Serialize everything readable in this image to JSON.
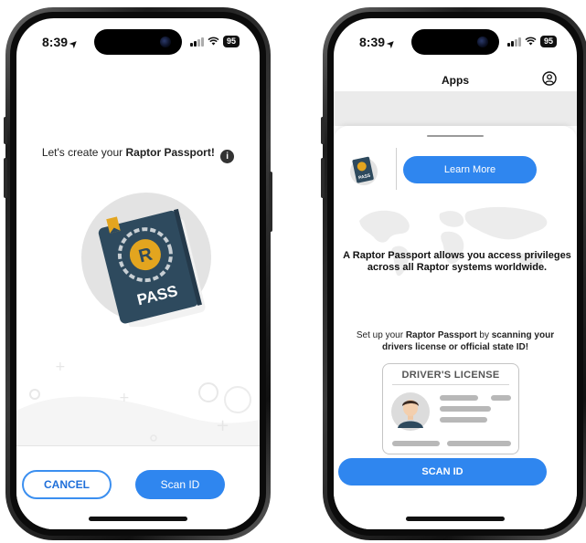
{
  "phone1": {
    "status": {
      "time": "8:39",
      "battery": "95"
    },
    "intro_prefix": "Let's create your ",
    "intro_brand": "Raptor Passport!",
    "info_glyph": "i",
    "pass_letter": "R",
    "pass_label": "PASS",
    "cancel_label": "CANCEL",
    "scan_label": "Scan ID"
  },
  "phone2": {
    "status": {
      "time": "8:39",
      "battery": "95"
    },
    "nav_title": "Apps",
    "learn_more_label": "Learn More",
    "mini_pass_label": "PASS",
    "access_text": "A Raptor Passport allows you access privileges across all Raptor systems worldwide.",
    "setup_prefix": "Set up your ",
    "setup_brand": "Raptor Passport",
    "setup_mid": " by ",
    "setup_bold": "scanning your drivers license or official state ID!",
    "license_title": "DRIVER'S LICENSE",
    "scan_label": "SCAN ID"
  },
  "colors": {
    "accent": "#2f86ef",
    "passport_cover": "#2e4a5e",
    "emblem_gold": "#e3a51f"
  },
  "icons": [
    "location-arrow-icon",
    "signal-icon",
    "wifi-icon",
    "battery-icon",
    "info-icon",
    "passport-icon",
    "profile-icon",
    "world-map-icon",
    "avatar-icon"
  ]
}
